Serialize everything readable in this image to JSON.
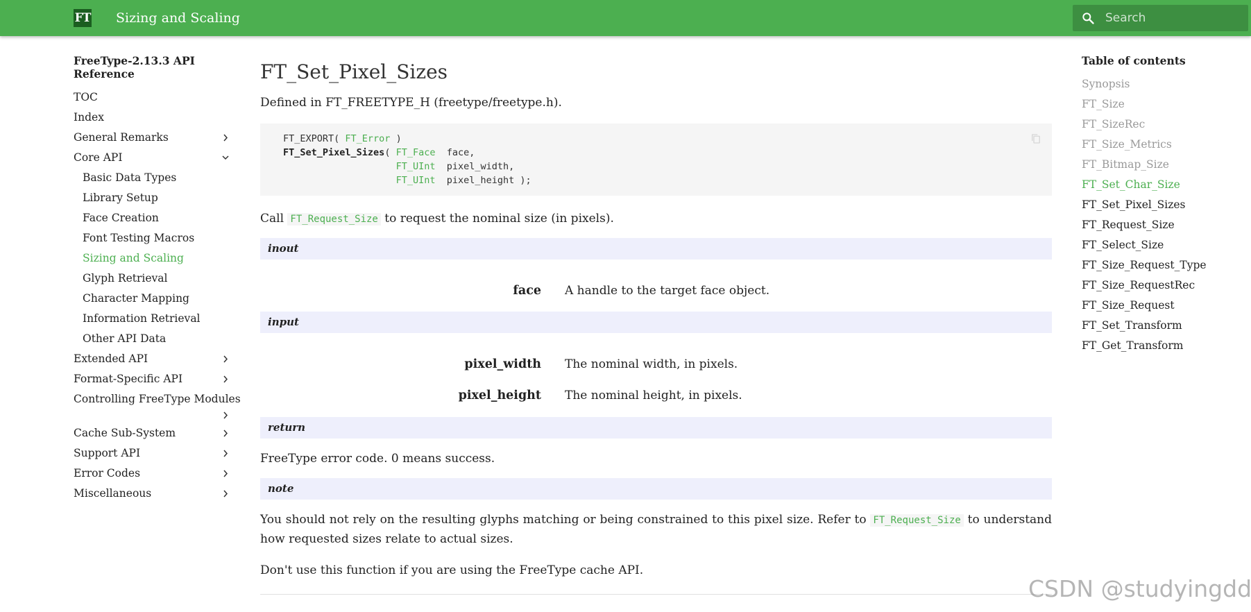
{
  "header": {
    "logo_text": "FT",
    "title": "Sizing and Scaling",
    "search_placeholder": "Search",
    "color": "#4caf50"
  },
  "sidebar": {
    "title": "FreeType-2.13.3 API Reference",
    "items": [
      {
        "label": "TOC",
        "level": 0
      },
      {
        "label": "Index",
        "level": 0
      },
      {
        "label": "General Remarks",
        "level": 0,
        "expandable": true
      },
      {
        "label": "Core API",
        "level": 0,
        "expanded": true
      },
      {
        "label": "Basic Data Types",
        "level": 1
      },
      {
        "label": "Library Setup",
        "level": 1
      },
      {
        "label": "Face Creation",
        "level": 1
      },
      {
        "label": "Font Testing Macros",
        "level": 1
      },
      {
        "label": "Sizing and Scaling",
        "level": 1,
        "active": true
      },
      {
        "label": "Glyph Retrieval",
        "level": 1
      },
      {
        "label": "Character Mapping",
        "level": 1
      },
      {
        "label": "Information Retrieval",
        "level": 1
      },
      {
        "label": "Other API Data",
        "level": 1
      },
      {
        "label": "Extended API",
        "level": 0,
        "expandable": true
      },
      {
        "label": "Format-Specific API",
        "level": 0,
        "expandable": true
      },
      {
        "label": "Controlling FreeType Modules",
        "level": 0,
        "expandable": true
      },
      {
        "label": "Cache Sub-System",
        "level": 0,
        "expandable": true
      },
      {
        "label": "Support API",
        "level": 0,
        "expandable": true
      },
      {
        "label": "Error Codes",
        "level": 0,
        "expandable": true
      },
      {
        "label": "Miscellaneous",
        "level": 0,
        "expandable": true
      }
    ]
  },
  "main": {
    "heading": "FT_Set_Pixel_Sizes",
    "defined_in": "Defined in FT_FREETYPE_H (freetype/freetype.h).",
    "code": {
      "l1_a": "FT_EXPORT( ",
      "l1_type": "FT_Error",
      "l1_b": " )",
      "l2_func": "FT_Set_Pixel_Sizes",
      "l2_a": "( ",
      "l2_type": "FT_Face",
      "l2_b": "  face,",
      "l3_type": "FT_UInt",
      "l3_b": "  pixel_width,",
      "l4_type": "FT_UInt",
      "l4_b": "  pixel_height );"
    },
    "call_pre": "Call ",
    "call_code": "FT_Request_Size",
    "call_post": " to request the nominal size (in pixels).",
    "inout_label": "inout",
    "inout_params": [
      {
        "name": "face",
        "desc": "A handle to the target face object."
      }
    ],
    "input_label": "input",
    "input_params": [
      {
        "name": "pixel_width",
        "desc": "The nominal width, in pixels."
      },
      {
        "name": "pixel_height",
        "desc": "The nominal height, in pixels."
      }
    ],
    "return_label": "return",
    "return_text": "FreeType error code. 0 means success.",
    "note_label": "note",
    "note_pre": "You should not rely on the resulting glyphs matching or being constrained to this pixel size. Refer to ",
    "note_code": "FT_Request_Size",
    "note_post": " to understand how requested sizes relate to actual sizes.",
    "note_2": "Don't use this function if you are using the FreeType cache API."
  },
  "toc": {
    "title": "Table of contents",
    "items": [
      {
        "label": "Synopsis",
        "state": "visited"
      },
      {
        "label": "FT_Size",
        "state": "visited"
      },
      {
        "label": "FT_SizeRec",
        "state": "visited"
      },
      {
        "label": "FT_Size_Metrics",
        "state": "visited"
      },
      {
        "label": "FT_Bitmap_Size",
        "state": "visited"
      },
      {
        "label": "FT_Set_Char_Size",
        "state": "active"
      },
      {
        "label": "FT_Set_Pixel_Sizes",
        "state": "normal"
      },
      {
        "label": "FT_Request_Size",
        "state": "normal"
      },
      {
        "label": "FT_Select_Size",
        "state": "normal"
      },
      {
        "label": "FT_Size_Request_Type",
        "state": "normal"
      },
      {
        "label": "FT_Size_RequestRec",
        "state": "normal"
      },
      {
        "label": "FT_Size_Request",
        "state": "normal"
      },
      {
        "label": "FT_Set_Transform",
        "state": "normal"
      },
      {
        "label": "FT_Get_Transform",
        "state": "normal"
      }
    ]
  },
  "watermark": "CSDN @studyingdda"
}
